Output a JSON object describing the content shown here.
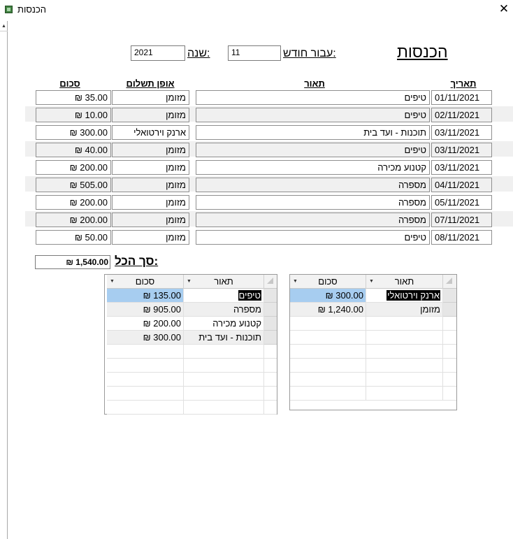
{
  "window": {
    "title": "הכנסות"
  },
  "form": {
    "title": "הכנסות",
    "month_label": "עבור חודש:",
    "month_value": "11",
    "year_label": "שנה:",
    "year_value": "2021"
  },
  "columns": {
    "date": "תאריך",
    "description": "תאור",
    "payment": "אופן תשלום",
    "amount": "סכום"
  },
  "rows": [
    {
      "date": "01/11/2021",
      "desc": "טיפים",
      "payment": "מזומן",
      "amount": "₪ 35.00"
    },
    {
      "date": "02/11/2021",
      "desc": "טיפים",
      "payment": "מזומן",
      "amount": "₪ 10.00"
    },
    {
      "date": "03/11/2021",
      "desc": "תוכנות - ועד בית",
      "payment": "ארנק וירטואלי",
      "amount": "₪ 300.00"
    },
    {
      "date": "03/11/2021",
      "desc": "טיפים",
      "payment": "מזומן",
      "amount": "₪ 40.00"
    },
    {
      "date": "03/11/2021",
      "desc": "קטנוע מכירה",
      "payment": "מזומן",
      "amount": "₪ 200.00"
    },
    {
      "date": "04/11/2021",
      "desc": "מספרה",
      "payment": "מזומן",
      "amount": "₪ 505.00"
    },
    {
      "date": "05/11/2021",
      "desc": "מספרה",
      "payment": "מזומן",
      "amount": "₪ 200.00"
    },
    {
      "date": "07/11/2021",
      "desc": "מספרה",
      "payment": "מזומן",
      "amount": "₪ 200.00"
    },
    {
      "date": "08/11/2021",
      "desc": "טיפים",
      "payment": "מזומן",
      "amount": "₪ 50.00"
    }
  ],
  "total": {
    "label": "סך הכל:",
    "value": "₪ 1,540.00"
  },
  "left_grid": {
    "headers": {
      "desc": "תאור",
      "amount": "סכום"
    },
    "rows": [
      {
        "desc": "טיפים",
        "amount": "₪ 135.00"
      },
      {
        "desc": "מספרה",
        "amount": "₪ 905.00"
      },
      {
        "desc": "קטנוע מכירה",
        "amount": "₪ 200.00"
      },
      {
        "desc": "תוכנות - ועד בית",
        "amount": "₪ 300.00"
      }
    ]
  },
  "right_grid": {
    "headers": {
      "desc": "תאור",
      "amount": "סכום"
    },
    "rows": [
      {
        "desc": "ארנק וירטואלי",
        "amount": "₪ 300.00"
      },
      {
        "desc": "מזומן",
        "amount": "₪ 1,240.00"
      }
    ]
  }
}
